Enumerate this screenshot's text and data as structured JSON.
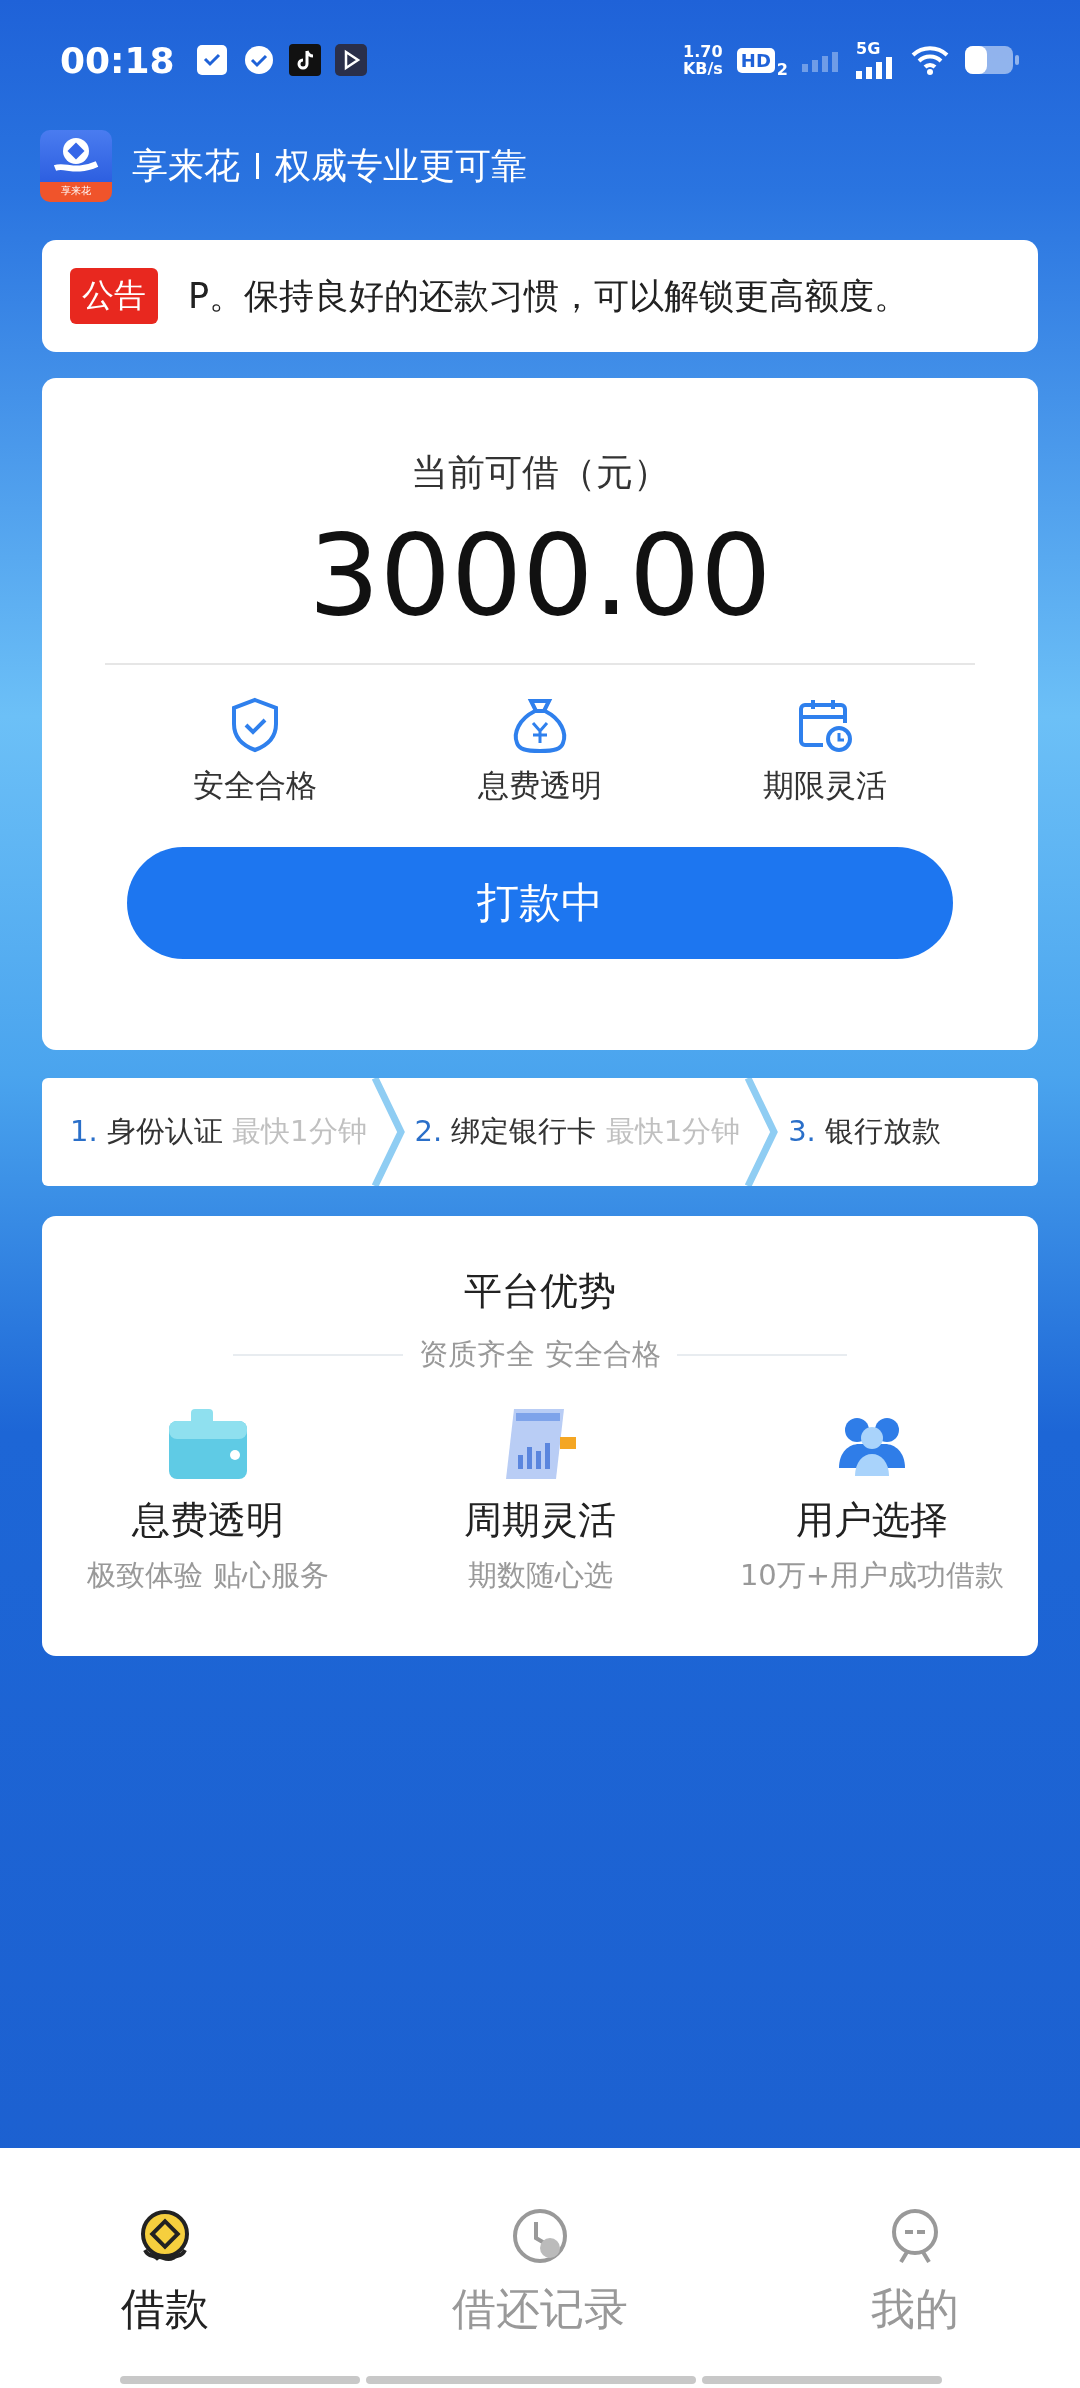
{
  "status_bar": {
    "time": "00:18",
    "net_speed": "1.70",
    "net_unit": "KB/s",
    "hd": "HD",
    "hd_sub": "2",
    "network": "5G"
  },
  "header": {
    "logo_text": "享来花",
    "brand": "享来花",
    "slogan": "权威专业更可靠"
  },
  "notice": {
    "badge": "公告",
    "text": "P。保持良好的还款习惯，可以解锁更高额度。"
  },
  "loan": {
    "label": "当前可借（元）",
    "amount": "3000.00",
    "features": [
      {
        "kind": "shield",
        "label": "安全合格"
      },
      {
        "kind": "money-bag",
        "label": "息费透明"
      },
      {
        "kind": "calendar",
        "label": "期限灵活"
      }
    ],
    "button": "打款中"
  },
  "steps": [
    {
      "number": "1.",
      "label": "身份认证",
      "hint": "最快1分钟"
    },
    {
      "number": "2.",
      "label": "绑定银行卡",
      "hint": "最快1分钟"
    },
    {
      "number": "3.",
      "label": "银行放款"
    }
  ],
  "advantages": {
    "title": "平台优势",
    "subtitle": "资质齐全 安全合格",
    "items": [
      {
        "kind": "wallet",
        "title": "息费透明",
        "desc": "极致体验 贴心服务"
      },
      {
        "kind": "report",
        "title": "周期灵活",
        "desc": "期数随心选"
      },
      {
        "kind": "users",
        "title": "用户选择",
        "desc": "10万+用户成功借款"
      }
    ]
  },
  "nav": [
    {
      "kind": "coin",
      "label": "借款",
      "selected": true
    },
    {
      "kind": "clock",
      "label": "借还记录",
      "selected": false
    },
    {
      "kind": "face",
      "label": "我的",
      "selected": false
    }
  ]
}
